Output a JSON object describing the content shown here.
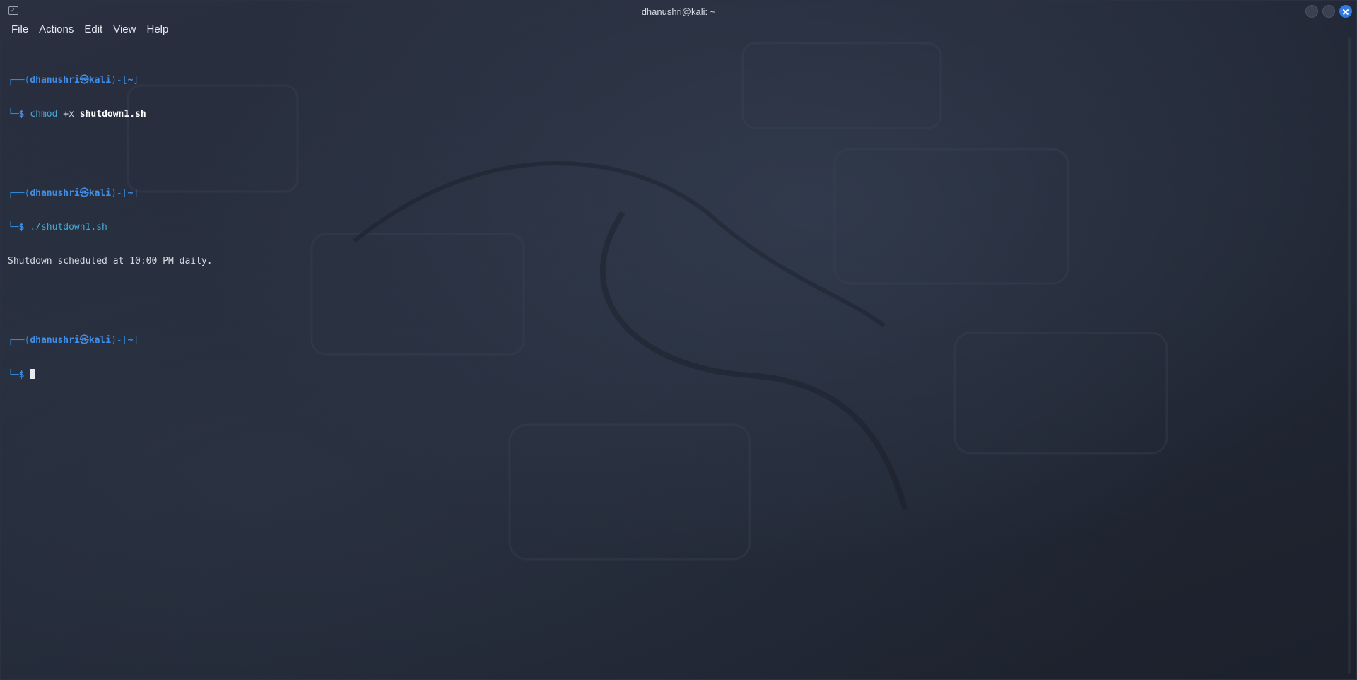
{
  "window": {
    "title": "dhanushri@kali: ~"
  },
  "menu": [
    "File",
    "Actions",
    "Edit",
    "View",
    "Help"
  ],
  "prompt": {
    "top_left": "┌──(",
    "user": "dhanushri",
    "at": "㉿",
    "host": "kali",
    "mid": ")-[",
    "dir": "~",
    "end": "]",
    "bottom_left": "└─",
    "dollar": "$"
  },
  "session": [
    {
      "command": "chmod",
      "args_plain": " +x ",
      "args_bold": "shutdown1.sh",
      "output": ""
    },
    {
      "command": "./shutdown1.sh",
      "args_plain": "",
      "args_bold": "",
      "output": "Shutdown scheduled at 10:00 PM daily."
    }
  ]
}
